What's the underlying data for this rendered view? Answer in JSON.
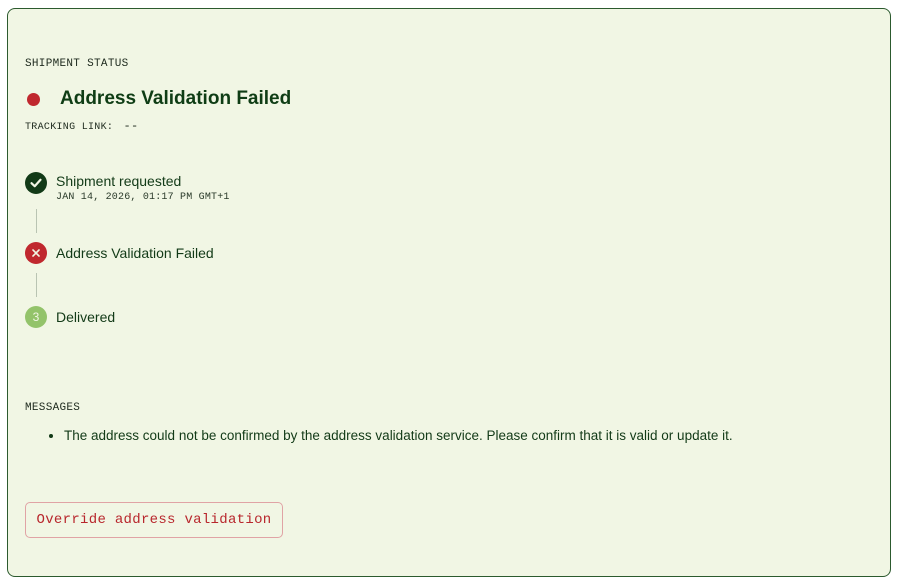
{
  "shipment": {
    "section_label": "SHIPMENT STATUS",
    "status_title": "Address Validation Failed",
    "status_color": "#c0282e",
    "tracking_label": "TRACKING LINK:",
    "tracking_value": "--"
  },
  "timeline": {
    "steps": [
      {
        "label": "Shipment requested",
        "timestamp": "JAN 14, 2026, 01:17 PM GMT+1",
        "state": "done",
        "icon": "check-circle-icon"
      },
      {
        "label": "Address Validation Failed",
        "timestamp": "",
        "state": "failed",
        "icon": "x-circle-icon"
      },
      {
        "label": "Delivered",
        "timestamp": "",
        "state": "pending",
        "number": "3"
      }
    ]
  },
  "messages": {
    "section_label": "MESSAGES",
    "items": [
      "The address could not be confirmed by the address validation service. Please confirm that it is valid or update it."
    ]
  },
  "actions": {
    "override_label": "Override address validation"
  },
  "colors": {
    "card_bg": "#f1f6e4",
    "card_border": "#2c5a2e",
    "text_primary": "#123a17",
    "error": "#c0282e",
    "pending": "#93c36a"
  }
}
